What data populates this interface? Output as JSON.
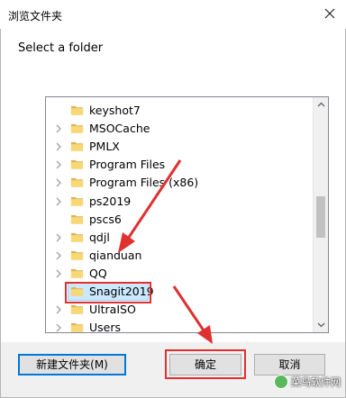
{
  "window": {
    "title": "浏览文件夹",
    "close_label": "✕"
  },
  "dialog": {
    "prompt": "Select a folder"
  },
  "tree": {
    "items": [
      {
        "label": "keyshot7",
        "has_children": false
      },
      {
        "label": "MSOCache",
        "has_children": true
      },
      {
        "label": "PMLX",
        "has_children": true
      },
      {
        "label": "Program Files",
        "has_children": true
      },
      {
        "label": "Program Files (x86)",
        "has_children": true
      },
      {
        "label": "ps2019",
        "has_children": true
      },
      {
        "label": "pscs6",
        "has_children": false
      },
      {
        "label": "qdjl",
        "has_children": true
      },
      {
        "label": "qianduan",
        "has_children": true
      },
      {
        "label": "QQ",
        "has_children": true
      },
      {
        "label": "Snagit2019",
        "has_children": false,
        "selected": true
      },
      {
        "label": "UltraISO",
        "has_children": true
      },
      {
        "label": "Users",
        "has_children": true
      }
    ]
  },
  "buttons": {
    "new_folder": "新建文件夹(M)",
    "ok": "确定",
    "cancel": "取消"
  },
  "watermark": {
    "text": "菜鸟软件网"
  },
  "colors": {
    "annotation_red": "#e03030",
    "selection": "#cce8ff",
    "focus_blue": "#0078d7"
  }
}
